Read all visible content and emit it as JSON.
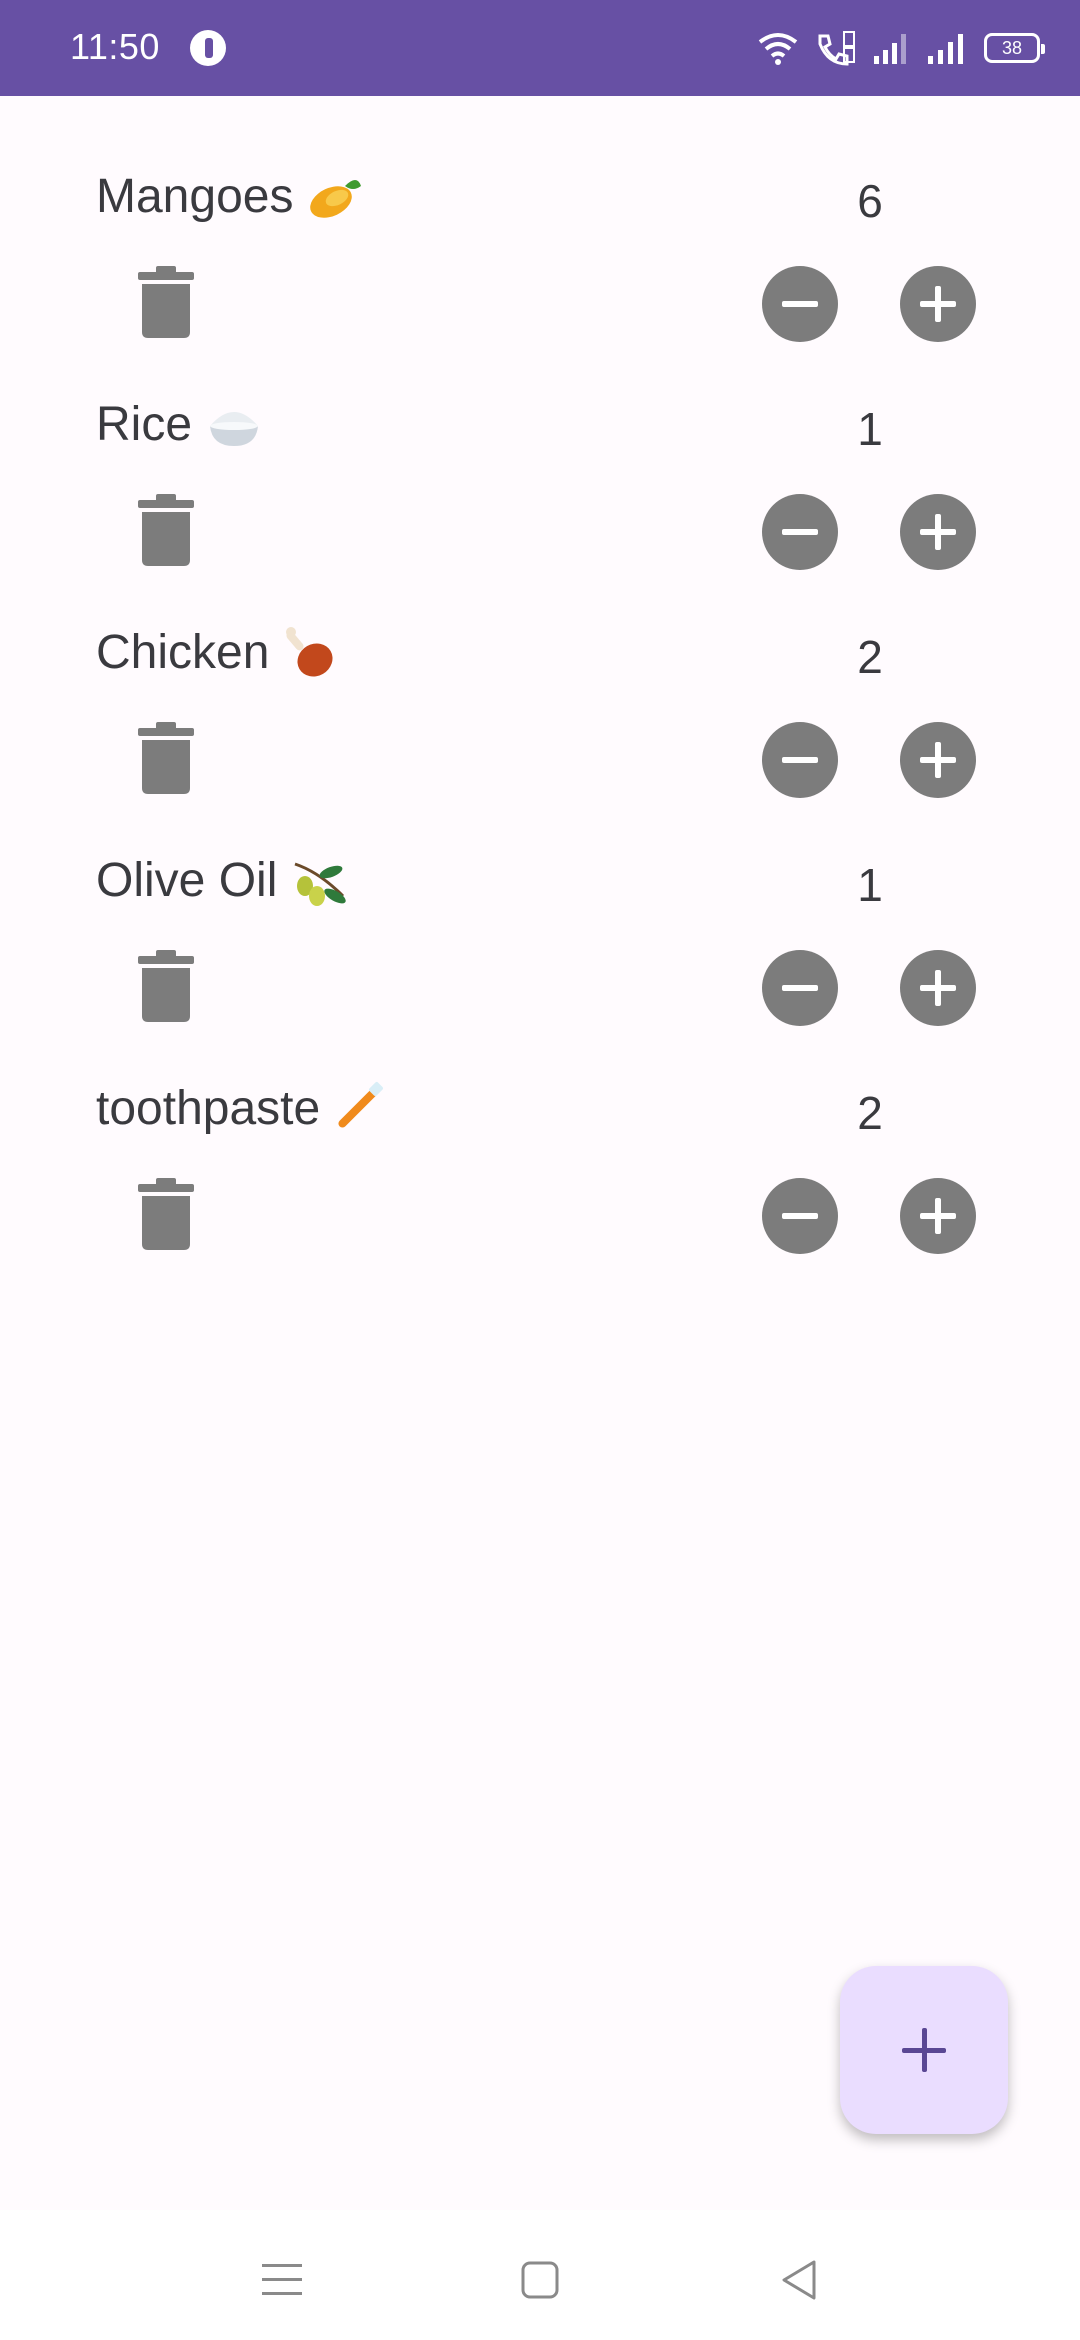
{
  "status_bar": {
    "time": "11:50",
    "battery": "38"
  },
  "items": [
    {
      "name": "Mangoes",
      "emoji": "mango",
      "qty": "6"
    },
    {
      "name": "Rice",
      "emoji": "rice",
      "qty": "1"
    },
    {
      "name": "Chicken",
      "emoji": "poultry-leg",
      "qty": "2"
    },
    {
      "name": "Olive Oil",
      "emoji": "olive",
      "qty": "1"
    },
    {
      "name": "toothpaste",
      "emoji": "toothbrush",
      "qty": "2"
    }
  ],
  "fab": {
    "icon": "plus-icon"
  },
  "colors": {
    "status_bar": "#6750a4",
    "background": "#fffbfe",
    "button_gray": "#7c7c7c",
    "fab_bg": "#eaddff",
    "fab_icon": "#5a4794"
  }
}
